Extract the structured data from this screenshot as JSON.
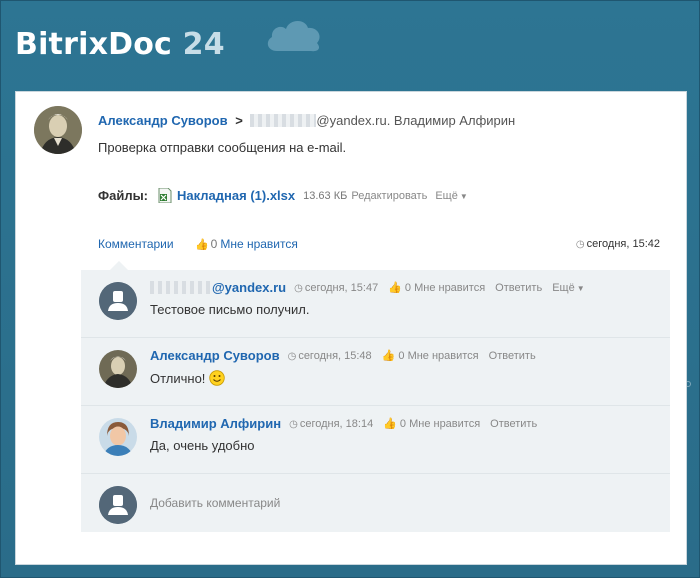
{
  "header": {
    "brand_name": "BitrixDoc",
    "brand_num": "24",
    "cloud_icon": "cloud-icon"
  },
  "post": {
    "author": "Александр Суворов",
    "arrow": ">",
    "recipient_suffix": "@yandex.ru. Владимир Алфирин",
    "text": "Проверка отправки сообщения на e-mail.",
    "files_label": "Файлы:",
    "file": {
      "icon": "xlsx-file-icon",
      "name": "Накладная (1).xlsx",
      "size": "13.63 КБ",
      "edit_label": "Редактировать",
      "more_label": "Ещё"
    },
    "actions": {
      "comments_label": "Комментарии",
      "like_count": "0",
      "like_label": "Мне нравится"
    },
    "time": "сегодня, 15:42"
  },
  "comments": [
    {
      "author": "@yandex.ru",
      "author_blurred_prefix": true,
      "time": "сегодня, 15:47",
      "like_count": "0",
      "like_label": "Мне нравится",
      "reply_label": "Ответить",
      "more_label": "Ещё",
      "text": "Тестовое письмо получил."
    },
    {
      "author": "Александр Суворов",
      "time": "сегодня, 15:48",
      "like_count": "0",
      "like_label": "Мне нравится",
      "reply_label": "Ответить",
      "text": "Отлично!"
    },
    {
      "author": "Владимир Алфирин",
      "time": "сегодня, 18:14",
      "like_count": "0",
      "like_label": "Мне нравится",
      "reply_label": "Ответить",
      "text": "Да, очень удобно"
    }
  ],
  "add_comment": {
    "placeholder": "Добавить комментарий"
  },
  "colors": {
    "background": "#2b6f8d",
    "link": "#2067b0",
    "comments_bg": "#eef2f4"
  }
}
